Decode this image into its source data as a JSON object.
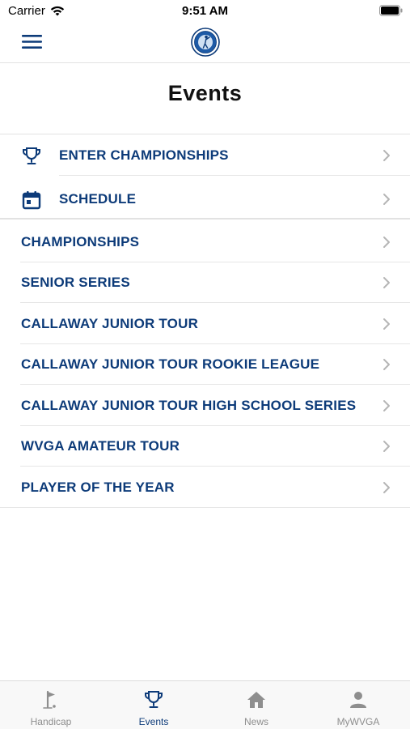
{
  "status": {
    "carrier": "Carrier",
    "time": "9:51 AM"
  },
  "page": {
    "title": "Events"
  },
  "primary_items": [
    {
      "label": "ENTER CHAMPIONSHIPS",
      "icon": "trophy-icon"
    },
    {
      "label": "SCHEDULE",
      "icon": "calendar-icon"
    }
  ],
  "event_items": [
    {
      "label": "CHAMPIONSHIPS"
    },
    {
      "label": "SENIOR SERIES"
    },
    {
      "label": "CALLAWAY JUNIOR TOUR"
    },
    {
      "label": "CALLAWAY JUNIOR TOUR ROOKIE LEAGUE"
    },
    {
      "label": "CALLAWAY JUNIOR TOUR HIGH SCHOOL SERIES"
    },
    {
      "label": "WVGA AMATEUR TOUR"
    },
    {
      "label": "PLAYER OF THE YEAR"
    }
  ],
  "tabs": [
    {
      "label": "Handicap",
      "icon": "golf-flag-icon",
      "active": false
    },
    {
      "label": "Events",
      "icon": "trophy-icon",
      "active": true
    },
    {
      "label": "News",
      "icon": "home-icon",
      "active": false
    },
    {
      "label": "MyWVGA",
      "icon": "person-icon",
      "active": false
    }
  ],
  "colors": {
    "brand": "#0d3b79",
    "inactive": "#8e8e8e",
    "divider": "#e2e2e2"
  }
}
